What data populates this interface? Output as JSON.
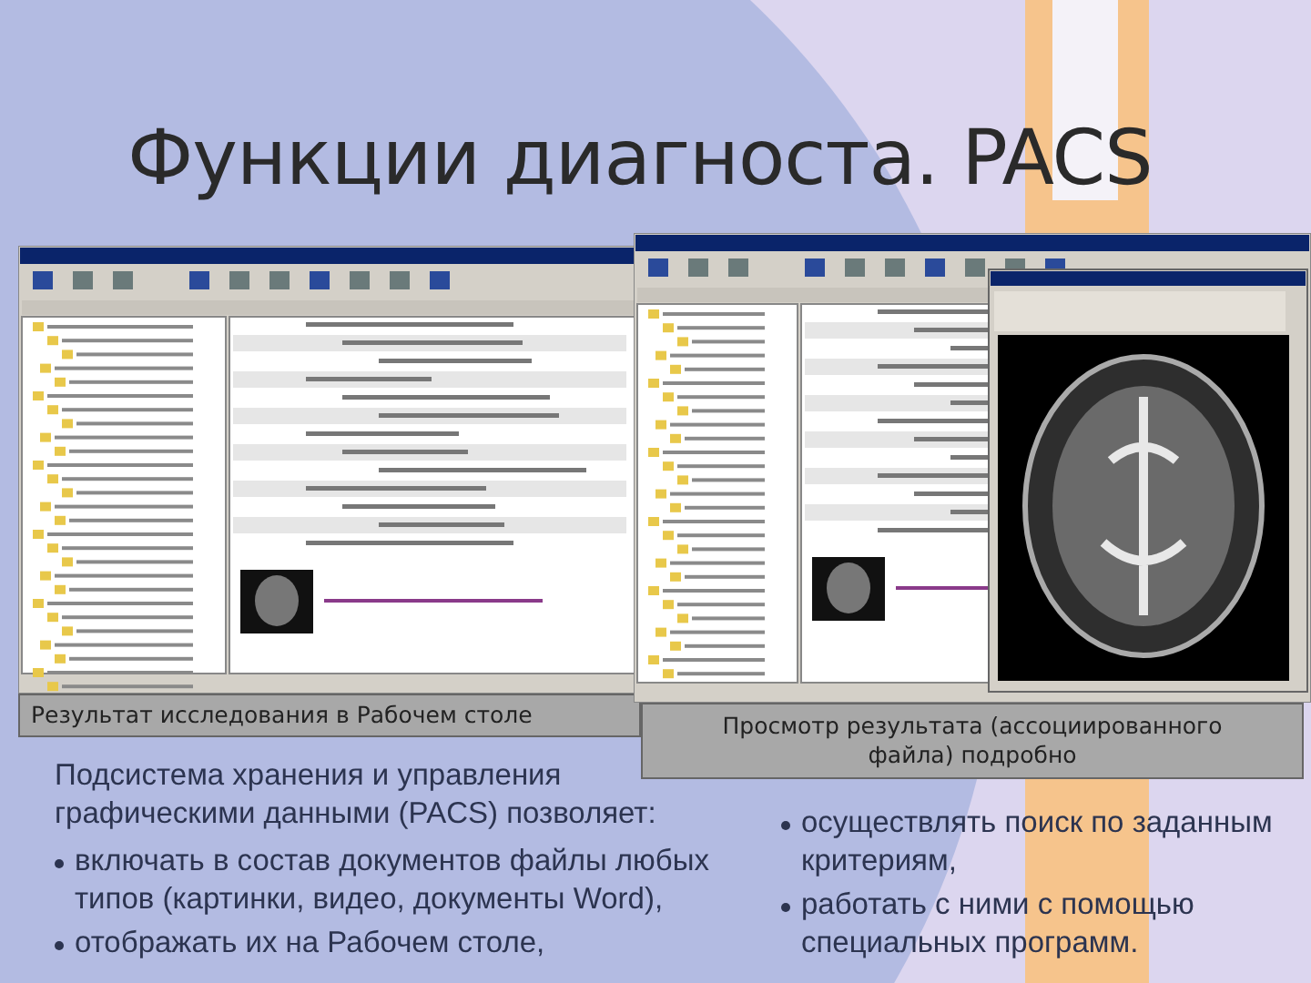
{
  "title": "Функции диагноста. PACS",
  "screenshots": [
    {
      "kind": "desktop",
      "caption": "Результат исследования в Рабочем столе"
    },
    {
      "kind": "viewer",
      "caption": "Просмотр результата (ассоциированного файла) подробно"
    }
  ],
  "intro": "Подсистема хранения и управления графическими данными (PACS) позволяет:",
  "bullets_left": [
    "включать в состав документов файлы любых типов (картинки, видео, документы Word),",
    "отображать их на Рабочем столе,"
  ],
  "bullets_right": [
    "осуществлять поиск по заданным критериям,",
    "работать с ними с помощью специальных программ."
  ]
}
